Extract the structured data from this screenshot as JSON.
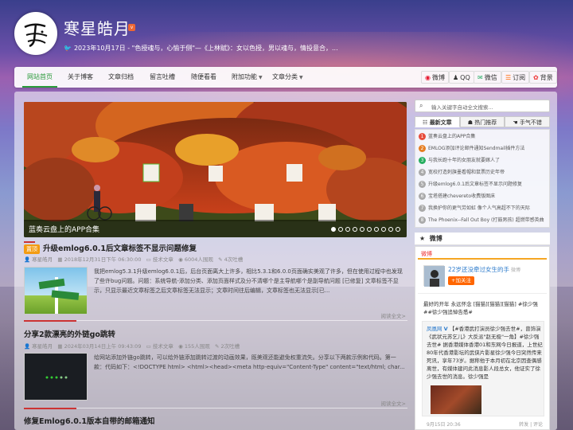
{
  "header": {
    "site_title": "寒星皓月",
    "vip": "v",
    "tagline": "2023年10月17日 - \"色授魂与，心愉于侧\"—《上林赋》：女以色授，男以魂与，情投意合，..."
  },
  "nav": {
    "items": [
      {
        "label": "网站首页",
        "active": true,
        "caret": false
      },
      {
        "label": "关于博客",
        "caret": false
      },
      {
        "label": "文章归档",
        "caret": false
      },
      {
        "label": "留言吐槽",
        "caret": false
      },
      {
        "label": "随便看看",
        "caret": false
      },
      {
        "label": "附加功能",
        "caret": true
      },
      {
        "label": "文章分类",
        "caret": true
      }
    ],
    "social": [
      {
        "label": "微博",
        "icon": "weibo-icon",
        "color": "#e6162d"
      },
      {
        "label": "QQ",
        "icon": "qq-icon",
        "color": "#333"
      },
      {
        "label": "微信",
        "icon": "wechat-icon",
        "color": "#2aae67"
      },
      {
        "label": "订阅",
        "icon": "rss-icon",
        "color": "#f60"
      },
      {
        "label": "背景",
        "icon": "background-icon",
        "color": "#e33"
      }
    ]
  },
  "slider": {
    "caption": "蓝奏云盘上的APP合集",
    "dot_count": 10,
    "active_dot": 0
  },
  "posts": [
    {
      "tag": "置顶",
      "title": "升级emlog6.0.1后文章标签不显示问题修复",
      "meta": [
        "寒星皓月",
        "2018年12月31日下午 06:30:00",
        "技术文章",
        "6004人围观",
        "4次吐槽"
      ],
      "excerpt": "我把emlog5.3.1升级emlog6.0.1后，后台页面离大上许多，相比5.3.1和6.0.0页面确实美观了许多，但在使用过程中也发现了些许bug问题。问题：系统导航-添加分类、添加页面样式及分不清哪个是主导航哪个是副导航问题 [已修复] 文章标签不显示，只显示最近文章标签之后文章标签无法显示；文章时间往后编辑，文章标签也无法显示[已...",
      "read_more": "阅读全文>"
    },
    {
      "tag": "",
      "title": "分享2款漂亮的外链go跳转",
      "meta": [
        "寒星皓月",
        "2024年03月14日上午 09:43:09",
        "技术文章",
        "155人围观",
        "2次吐槽"
      ],
      "excerpt": "给网站添加外链go跳转，可以给外链添加跳转过渡的动画效果，既美观还能避免权重流失。分享以下两款示例和代码。第一款：代码如下：<!DOCTYPE html> <html><head><meta http-equiv=\"Content-Type\" content=\"text/html; char...",
      "read_more": "阅读全文>"
    },
    {
      "tag": "",
      "title": "修复Emlog6.0.1版本自带的邮箱通知"
    }
  ],
  "sidebar": {
    "search_placeholder": "输入关键字自动全文搜索...",
    "tabs": [
      {
        "label": "最新文章",
        "active": true
      },
      {
        "label": "热门推荐",
        "active": false
      },
      {
        "label": "手气不错",
        "active": false
      }
    ],
    "hot_list": [
      {
        "num": "1",
        "title": "蓝奏云盘上的APP合集",
        "color": "#e74c3c"
      },
      {
        "num": "2",
        "title": "EMLOG添加评论邮件通知Sendmail插件方法",
        "color": "#e67e22"
      },
      {
        "num": "3",
        "title": "与我长跑十年的女朋友就要嫁人了",
        "color": "#27ae60"
      },
      {
        "num": "4",
        "title": "宽校打造刺旗墨看帽和鼠票历史年帝",
        "color": "#aaa"
      },
      {
        "num": "5",
        "title": "升级emlog6.0.1后文章标签不显示问题修复",
        "color": "#aaa"
      },
      {
        "num": "6",
        "title": "宝塔搭建chevereto收费版图床",
        "color": "#aaa"
      },
      {
        "num": "7",
        "title": "我换护你的更气劳如虹 像个人气高超不下的天际",
        "color": "#aaa"
      },
      {
        "num": "8",
        "title": "The Phoenix--Fall Out Boy (打鼓男孩) 超燃带感英曲",
        "color": "#aaa"
      }
    ],
    "weibo": {
      "header": "微博",
      "tab": "微博",
      "name": "22岁还没牵过女生的手",
      "name_suffix": "微博",
      "follow": "+加关注",
      "post1": "最好的开年 永远怀念 [猫猫][猫猫][猫猫] #徐少强##徐少强追悼告悉#",
      "repost_author": "凤凰网",
      "repost_text": "【#香港武打演员徐少强去世#，曾饰演《武状元苏乞儿》大反派\"赵无极\"一角】#徐少强去世# 据香港媒体香港01和东网今日报道，上世纪80年代香港影坛的武侠片影星徐少强今日突然传来死讯，享年73岁。据称他于本月初在北京因查偶感离世，有媒体建问此消息影人段总女，他证实了徐少强去世的消息。徐少强是",
      "time": "9月15日 20:36",
      "actions": "转发 | 评论"
    }
  }
}
